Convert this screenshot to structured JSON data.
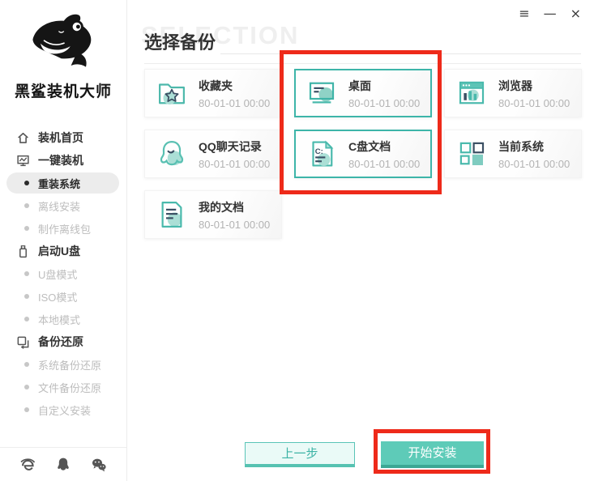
{
  "window": {
    "controls": [
      {
        "name": "hamburger-menu",
        "glyph": "≡"
      },
      {
        "name": "minimize",
        "glyph": "—"
      },
      {
        "name": "close",
        "glyph": "×"
      }
    ]
  },
  "sidebar": {
    "app_name": "黑鲨装机大师",
    "menu": [
      {
        "label": "装机首页",
        "type": "top",
        "icon": "home-icon",
        "state": "normal"
      },
      {
        "label": "一键装机",
        "type": "top",
        "icon": "monitor-chart-icon",
        "state": "normal"
      },
      {
        "label": "重装系统",
        "type": "sub",
        "icon": "bullet-icon",
        "state": "active"
      },
      {
        "label": "离线安装",
        "type": "sub",
        "icon": "bullet-icon",
        "state": "muted"
      },
      {
        "label": "制作离线包",
        "type": "sub",
        "icon": "bullet-icon",
        "state": "muted"
      },
      {
        "label": "启动U盘",
        "type": "top",
        "icon": "usb-drive-icon",
        "state": "normal"
      },
      {
        "label": "U盘模式",
        "type": "sub",
        "icon": "bullet-icon",
        "state": "muted"
      },
      {
        "label": "ISO模式",
        "type": "sub",
        "icon": "bullet-icon",
        "state": "muted"
      },
      {
        "label": "本地模式",
        "type": "sub",
        "icon": "bullet-icon",
        "state": "muted"
      },
      {
        "label": "备份还原",
        "type": "top",
        "icon": "backup-restore-icon",
        "state": "normal"
      },
      {
        "label": "系统备份还原",
        "type": "sub",
        "icon": "bullet-icon",
        "state": "muted"
      },
      {
        "label": "文件备份还原",
        "type": "sub",
        "icon": "bullet-icon",
        "state": "muted"
      },
      {
        "label": "自定义安装",
        "type": "sub",
        "icon": "bullet-icon",
        "state": "muted"
      }
    ],
    "dock": [
      {
        "icon": "ie-browser-icon"
      },
      {
        "icon": "qq-penguin-icon"
      },
      {
        "icon": "wechat-icon"
      }
    ]
  },
  "main": {
    "ghost_title": "SELECTION",
    "title": "选择备份",
    "cards": [
      {
        "label": "收藏夹",
        "time": "80-01-01 00:00",
        "icon": "favorites-folder-icon",
        "selected": false
      },
      {
        "label": "桌面",
        "time": "80-01-01 00:00",
        "icon": "desktop-icon",
        "selected": true
      },
      {
        "label": "浏览器",
        "time": "80-01-01 00:00",
        "icon": "browser-icon",
        "selected": false
      },
      {
        "label": "QQ聊天记录",
        "time": "80-01-01 00:00",
        "icon": "qq-chat-icon",
        "selected": false
      },
      {
        "label": "C盘文档",
        "time": "80-01-01 00:00",
        "icon": "c-drive-doc-icon",
        "selected": true
      },
      {
        "label": "当前系统",
        "time": "80-01-01 00:00",
        "icon": "current-system-icon",
        "selected": false
      },
      {
        "label": "我的文档",
        "time": "80-01-01 00:00",
        "icon": "my-documents-icon",
        "selected": false
      }
    ],
    "buttons": {
      "prev": "上一步",
      "start": "开始安装"
    }
  },
  "annotations": {
    "color": "#ee2a1a",
    "boxes": [
      "selected-backup-cards",
      "start-install-button"
    ]
  },
  "colors": {
    "accent": "#4cbcae",
    "accent_fill": "#5ecbb8",
    "accent_dark": "#3ca794",
    "light_teal": "#a9ddd4",
    "navy": "#3b4f63",
    "red": "#ee2a1a",
    "text_dark": "#333333",
    "text_muted": "#b3b3b3",
    "sidebar_muted": "#bdbdbd"
  }
}
